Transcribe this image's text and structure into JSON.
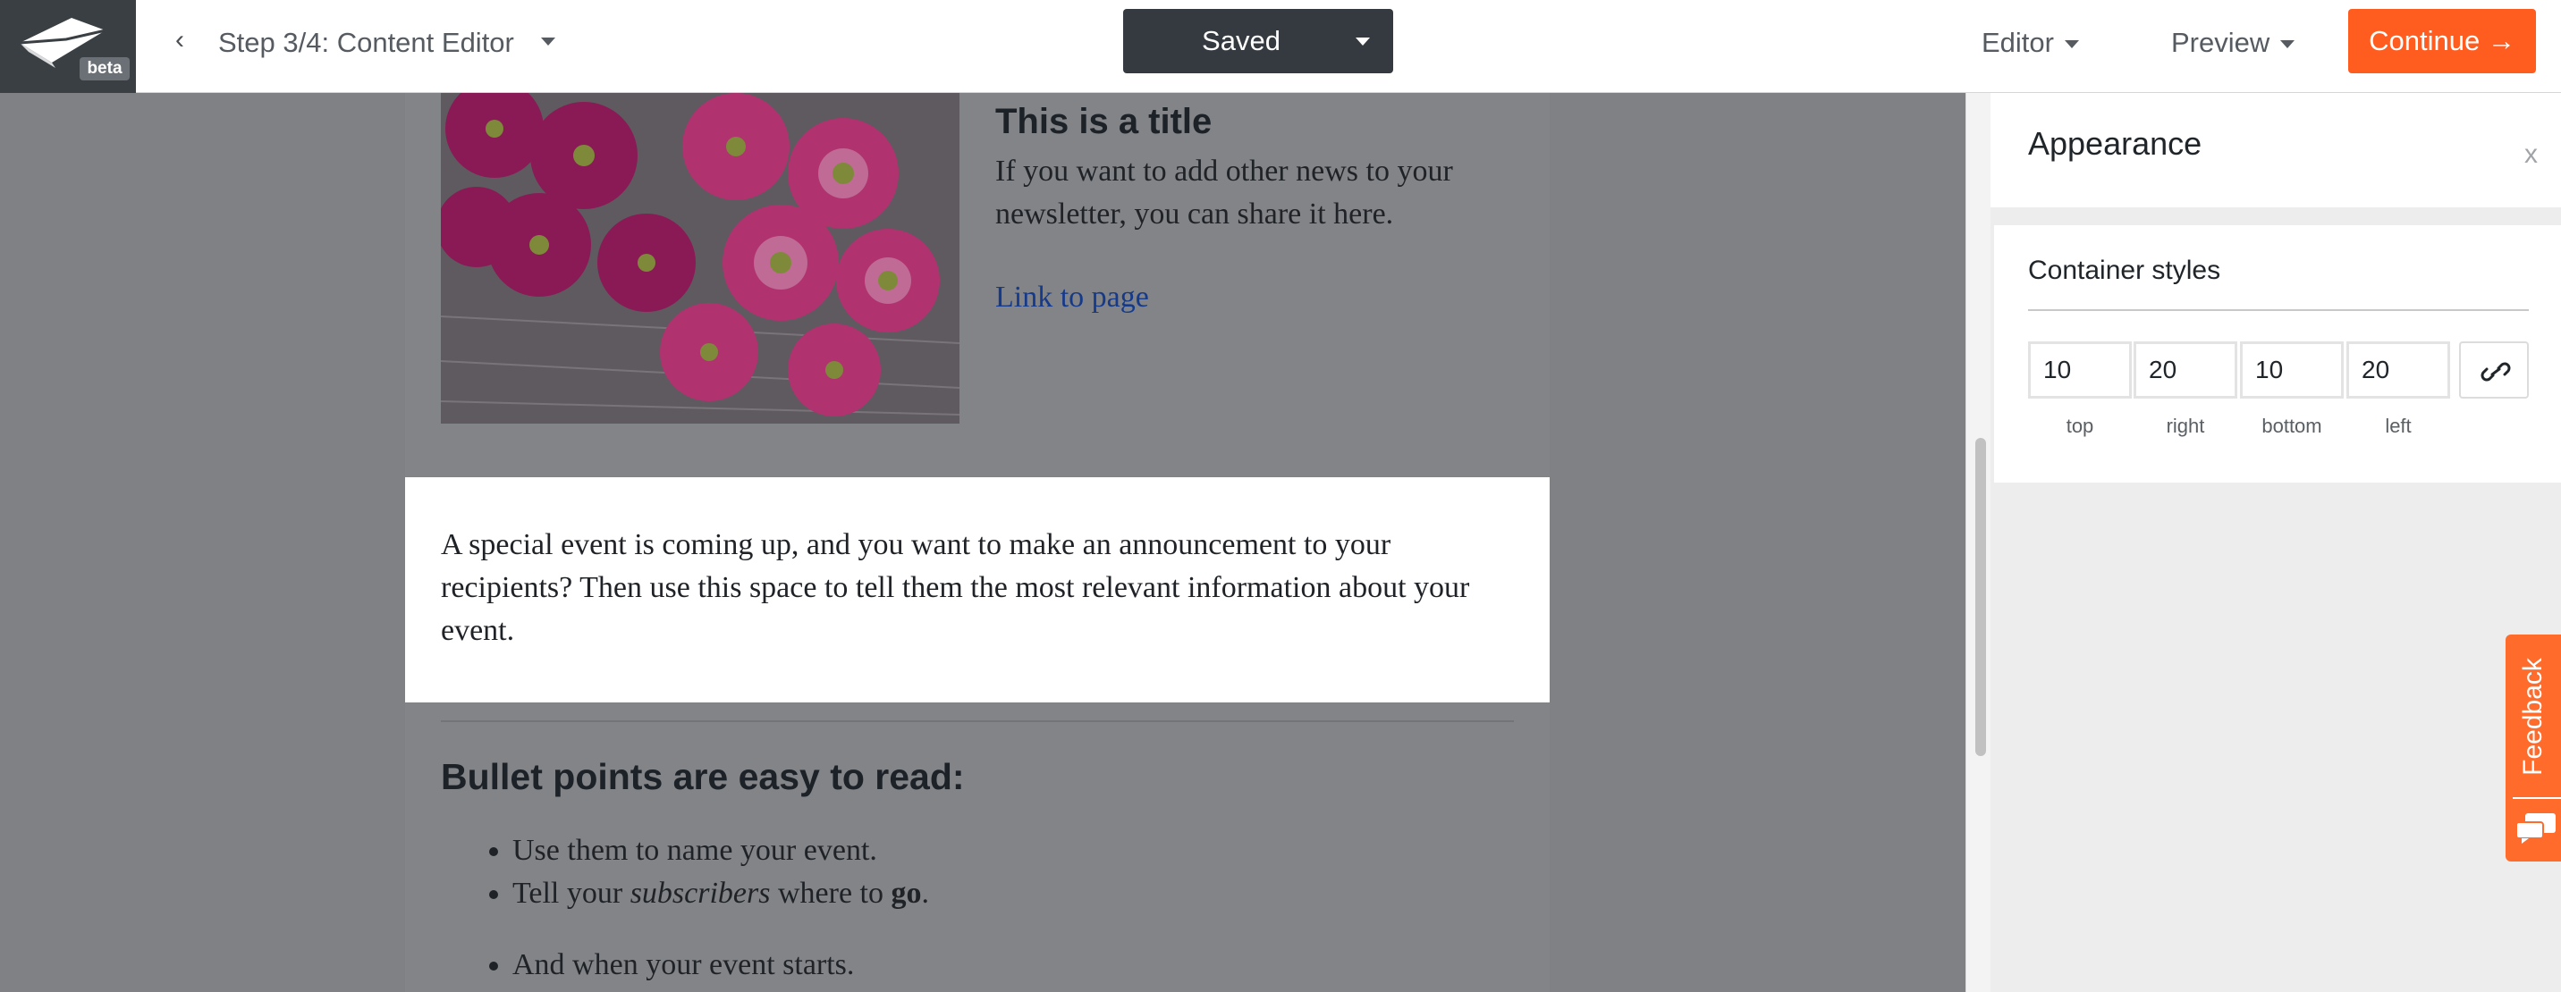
{
  "topbar": {
    "logo_badge": "beta",
    "back_glyph": "‹",
    "step_label": "Step 3/4: Content Editor",
    "saved_label": "Saved",
    "editor_menu": "Editor",
    "preview_menu": "Preview",
    "continue_label": "Continue →"
  },
  "email": {
    "news": {
      "title": "This is a title",
      "text": "If you want to add other news to your newsletter, you can share it here.",
      "link": "Link to page"
    },
    "event_text": "A special event is coming up, and you want to make an announcement to your recipients? Then use this space to tell them the most relevant information about your event.",
    "bullets_heading": "Bullet points are easy to read:",
    "bullet_1": "Use them to name your event.",
    "bullet_2_pre": "Tell your ",
    "bullet_2_em": "subscribers",
    "bullet_2_mid": " where to ",
    "bullet_2_strong": "go",
    "bullet_2_post": ".",
    "bullet_3": "And when your event starts."
  },
  "panel": {
    "title": "Appearance",
    "close": "x",
    "section_title": "Container styles",
    "padding": {
      "top": "10",
      "top_label": "top",
      "right": "20",
      "right_label": "right",
      "bottom": "10",
      "bottom_label": "bottom",
      "left": "20",
      "left_label": "left"
    }
  },
  "feedback": {
    "label": "Feedback"
  },
  "colors": {
    "accent": "#ff5d1f",
    "dark": "#343a40",
    "link": "#163a8a",
    "overlay": "#7f8184"
  },
  "icons": [
    "logo-envelope-icon",
    "chevron-left-icon",
    "caret-down-icon",
    "close-icon",
    "link-icon",
    "chat-icon"
  ]
}
